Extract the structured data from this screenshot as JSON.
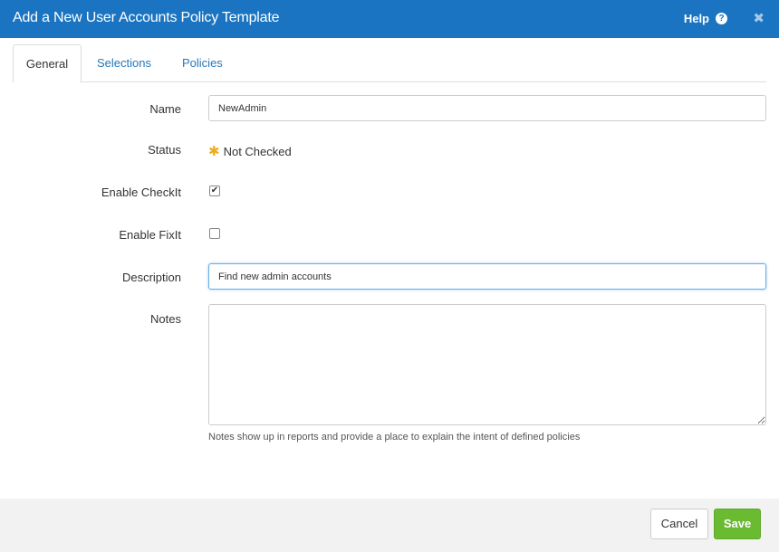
{
  "dialog": {
    "title": "Add a New User Accounts Policy Template",
    "help_label": "Help",
    "help_icon_glyph": "?",
    "close_glyph": "✖"
  },
  "tabs": [
    {
      "label": "General",
      "active": true
    },
    {
      "label": "Selections",
      "active": false
    },
    {
      "label": "Policies",
      "active": false
    }
  ],
  "form": {
    "name_label": "Name",
    "name_value": "NewAdmin",
    "status_label": "Status",
    "status_value": "Not Checked",
    "status_icon": "asterisk-icon",
    "status_color": "#f0ad18",
    "enable_checkit_label": "Enable CheckIt",
    "enable_checkit_checked": true,
    "enable_fixit_label": "Enable FixIt",
    "enable_fixit_checked": false,
    "description_label": "Description",
    "description_value": "Find new admin accounts",
    "notes_label": "Notes",
    "notes_value": "",
    "notes_hint": "Notes show up in reports and provide a place to explain the intent of defined policies"
  },
  "footer": {
    "cancel_label": "Cancel",
    "save_label": "Save"
  },
  "colors": {
    "header": "#1b74c1",
    "link": "#2a78b8",
    "save": "#6aba32"
  }
}
